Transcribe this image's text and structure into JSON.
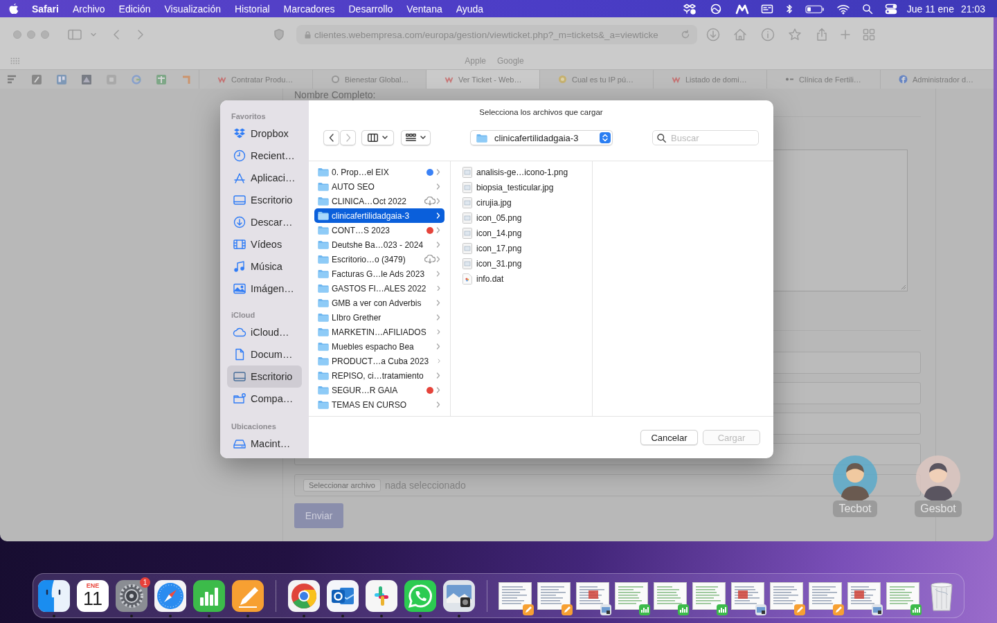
{
  "menubar": {
    "app": "Safari",
    "menus": [
      "Archivo",
      "Edición",
      "Visualización",
      "Historial",
      "Marcadores",
      "Desarrollo",
      "Ventana",
      "Ayuda"
    ],
    "date": "Jue 11 ene",
    "time": "21:03"
  },
  "browser": {
    "url": "clientes.webempresa.com/europa/gestion/viewticket.php?_m=tickets&_a=viewticke",
    "favorites": [
      "Apple",
      "Google"
    ],
    "tabs": [
      {
        "title": "Contratar Produ…",
        "selected": false
      },
      {
        "title": "Bienestar Global…",
        "selected": false
      },
      {
        "title": "Ver Ticket - Web…",
        "selected": true
      },
      {
        "title": "Cual es tu IP pú…",
        "selected": false
      },
      {
        "title": "Listado de domi…",
        "selected": false
      },
      {
        "title": "Clínica de Fertili…",
        "selected": false
      },
      {
        "title": "Administrador d…",
        "selected": false
      }
    ]
  },
  "page": {
    "name_label": "Nombre Completo:",
    "file_button": "Seleccionar archivo",
    "file_status": "nada seleccionado",
    "submit": "Enviar",
    "bots": [
      {
        "name": "Tecbot"
      },
      {
        "name": "Gesbot"
      }
    ]
  },
  "dialog": {
    "title": "Selecciona los archivos que cargar",
    "sidebar": [
      {
        "heading": "Favoritos",
        "items": [
          {
            "label": "Dropbox",
            "selected": false
          },
          {
            "label": "Recient…",
            "selected": false
          },
          {
            "label": "Aplicaci…",
            "selected": false
          },
          {
            "label": "Escritorio",
            "selected": false
          },
          {
            "label": "Descar…",
            "selected": false
          },
          {
            "label": "Vídeos",
            "selected": false
          },
          {
            "label": "Música",
            "selected": false
          },
          {
            "label": "Imágen…",
            "selected": false
          }
        ]
      },
      {
        "heading": "iCloud",
        "items": [
          {
            "label": "iCloud…",
            "selected": false
          },
          {
            "label": "Docum…",
            "selected": false
          },
          {
            "label": "Escritorio",
            "selected": true
          },
          {
            "label": "Compa…",
            "selected": false
          }
        ]
      },
      {
        "heading": "Ubicaciones",
        "items": [
          {
            "label": "Macint…",
            "selected": false
          }
        ]
      }
    ],
    "location": "clinicafertilidadgaia-3",
    "search_placeholder": "Buscar",
    "folders": [
      {
        "name": "0. Prop…el EIX",
        "selected": false,
        "cloud": false,
        "color": "#3b82f6"
      },
      {
        "name": "AUTO SEO",
        "selected": false,
        "cloud": false
      },
      {
        "name": "CLINICA…Oct 2022",
        "selected": false,
        "cloud": true
      },
      {
        "name": "clinicafertilidadgaia-3",
        "selected": true,
        "cloud": false
      },
      {
        "name": "CONT…S 2023",
        "selected": false,
        "cloud": false,
        "color": "#e5443b"
      },
      {
        "name": "Deutshe Ba…023 - 2024",
        "selected": false,
        "cloud": false
      },
      {
        "name": "Escritorio…o (3479)",
        "selected": false,
        "cloud": true
      },
      {
        "name": "Facturas G…le Ads 2023",
        "selected": false,
        "cloud": false
      },
      {
        "name": "GASTOS FI…ALES 2022",
        "selected": false,
        "cloud": false
      },
      {
        "name": "GMB a ver con Adverbis",
        "selected": false,
        "cloud": false
      },
      {
        "name": "LIbro Grether",
        "selected": false,
        "cloud": false
      },
      {
        "name": "MARKETIN…AFILIADOS",
        "selected": false,
        "cloud": false
      },
      {
        "name": "Muebles espacho Bea",
        "selected": false,
        "cloud": false
      },
      {
        "name": "PRODUCT…a Cuba 2023",
        "selected": false,
        "cloud": false
      },
      {
        "name": "REPISO, ci…tratamiento",
        "selected": false,
        "cloud": false
      },
      {
        "name": "SEGUR…R GAIA",
        "selected": false,
        "cloud": false,
        "color": "#e5443b"
      },
      {
        "name": "TEMAS EN CURSO",
        "selected": false,
        "cloud": false
      }
    ],
    "files": [
      {
        "name": "analisis-ge…icono-1.png",
        "kind": "image"
      },
      {
        "name": "biopsia_testicular.jpg",
        "kind": "image"
      },
      {
        "name": "cirujia.jpg",
        "kind": "image"
      },
      {
        "name": "icon_05.png",
        "kind": "image"
      },
      {
        "name": "icon_14.png",
        "kind": "image"
      },
      {
        "name": "icon_17.png",
        "kind": "image"
      },
      {
        "name": "icon_31.png",
        "kind": "image"
      },
      {
        "name": "info.dat",
        "kind": "data"
      }
    ],
    "buttons": [
      {
        "label": "Cancelar",
        "disabled": false
      },
      {
        "label": "Cargar",
        "disabled": true
      }
    ]
  },
  "dock": {
    "apps": [
      {
        "running": true
      },
      {
        "running": false,
        "month": "ENE",
        "day": "11"
      },
      {
        "running": true,
        "badge": "1"
      },
      {
        "running": true
      },
      {
        "running": true
      },
      {
        "running": true
      },
      {
        "running": true
      },
      {
        "running": true
      },
      {
        "running": true
      },
      {
        "running": true
      },
      {
        "running": true
      }
    ],
    "windows": [
      {
        "kind": "pages"
      },
      {
        "kind": "pages"
      },
      {
        "kind": "preview"
      },
      {
        "kind": "numbers"
      },
      {
        "kind": "numbers"
      },
      {
        "kind": "numbers"
      },
      {
        "kind": "preview"
      },
      {
        "kind": "pages"
      },
      {
        "kind": "pages"
      },
      {
        "kind": "preview"
      },
      {
        "kind": "numbers"
      }
    ]
  }
}
